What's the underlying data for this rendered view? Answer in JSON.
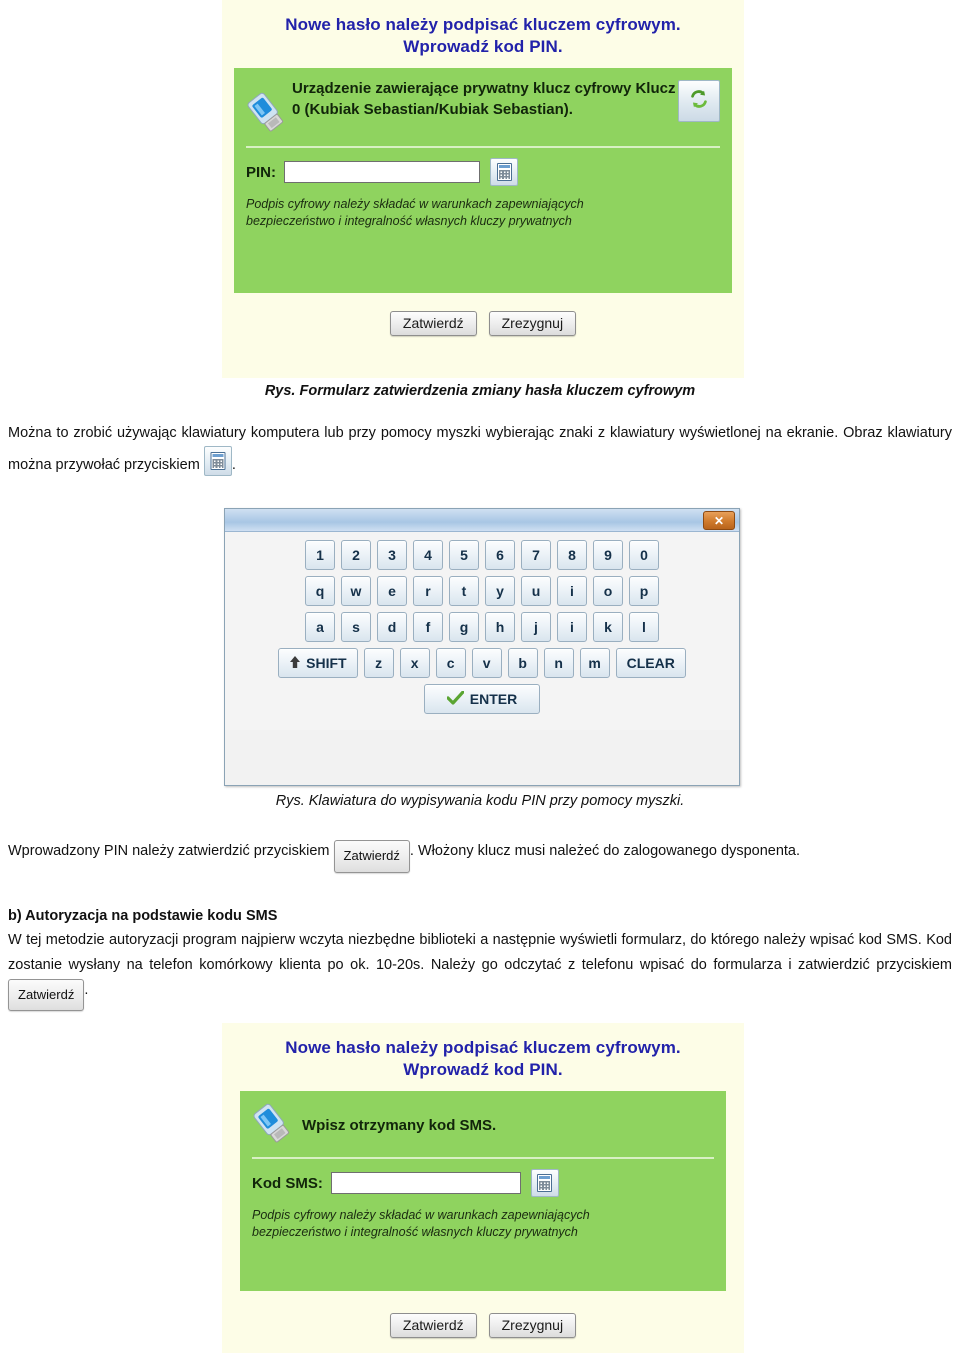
{
  "form_pin": {
    "title_line1": "Nowe hasło należy podpisać kluczem cyfrowym.",
    "title_line2": "Wprowadź kod PIN.",
    "device_text": "Urządzenie zawierające prywatny klucz cyfrowy Klucz 0 (Kubiak Sebastian/Kubiak Sebastian).",
    "refresh_icon": "refresh-icon",
    "usb_icon": "usb-token-icon",
    "pin_label": "PIN:",
    "pin_value": "",
    "pin_placeholder": "",
    "keyboard_icon": "onscreen-keyboard-icon",
    "note_line1": "Podpis cyfrowy należy składać  w warunkach zapewniających",
    "note_line2": "bezpieczeństwo i integralność własnych kluczy prywatnych",
    "confirm_label": "Zatwierdź",
    "cancel_label": "Zrezygnuj"
  },
  "caption_1": "Rys.  Formularz zatwierdzenia zmiany hasła kluczem cyfrowym",
  "para_1": {
    "part1": "Można to zrobić używając klawiatury komputera lub przy pomocy myszki wybierając znaki z klawiatury wyświetlonej na ekranie. Obraz klawiatury można przywołać przyciskiem",
    "icon": "onscreen-keyboard-icon",
    "part2": "."
  },
  "keyboard_window": {
    "close_label": "✕",
    "rows": [
      [
        "1",
        "2",
        "3",
        "4",
        "5",
        "6",
        "7",
        "8",
        "9",
        "0"
      ],
      [
        "q",
        "w",
        "e",
        "r",
        "t",
        "y",
        "u",
        "i",
        "o",
        "p"
      ],
      [
        "a",
        "s",
        "d",
        "f",
        "g",
        "h",
        "j",
        "i",
        "k",
        "l"
      ],
      [
        "SHIFT",
        "z",
        "x",
        "c",
        "v",
        "b",
        "n",
        "m",
        "CLEAR"
      ],
      [
        "ENTER"
      ]
    ],
    "shift_icon": "up-arrow-icon",
    "enter_icon": "green-check-icon"
  },
  "caption_2": "Rys.  Klawiatura do wypisywania kodu PIN przy pomocy myszki.",
  "para_2": {
    "part1": "Wprowadzony PIN należy zatwierdzić przyciskiem",
    "button": "Zatwierdź",
    "part2": ". Włożony klucz musi należeć do zalogowanego dysponenta."
  },
  "section_b": {
    "heading": "b) Autoryzacja na podstawie kodu SMS",
    "part1": "W tej metodzie autoryzacji program najpierw wczyta niezbędne biblioteki a następnie wyświetli formularz, do którego należy wpisać kod SMS. Kod zostanie wysłany na telefon komórkowy klienta po ok. 10-20s. Należy go odczytać z telefonu wpisać do formularza i zatwierdzić przyciskiem",
    "button": "Zatwierdź",
    "part2": "."
  },
  "form_sms": {
    "title_line1": "Nowe hasło należy podpisać kluczem cyfrowym.",
    "title_line2": "Wprowadź kod PIN.",
    "device_text": "Wpisz otrzymany kod SMS.",
    "usb_icon": "usb-token-icon",
    "sms_label": "Kod SMS:",
    "sms_value": "",
    "sms_placeholder": "",
    "keyboard_icon": "onscreen-keyboard-icon",
    "note_line1": "Podpis cyfrowy należy składać  w warunkach zapewniających",
    "note_line2": "bezpieczeństwo i integralność własnych kluczy prywatnych",
    "confirm_label": "Zatwierdź",
    "cancel_label": "Zrezygnuj"
  },
  "colors": {
    "panel_bg": "#fdfde7",
    "green": "#8fd35f",
    "title_blue": "#2222aa",
    "key_blue": "#15314a",
    "close_orange": "#cf7a2c"
  }
}
